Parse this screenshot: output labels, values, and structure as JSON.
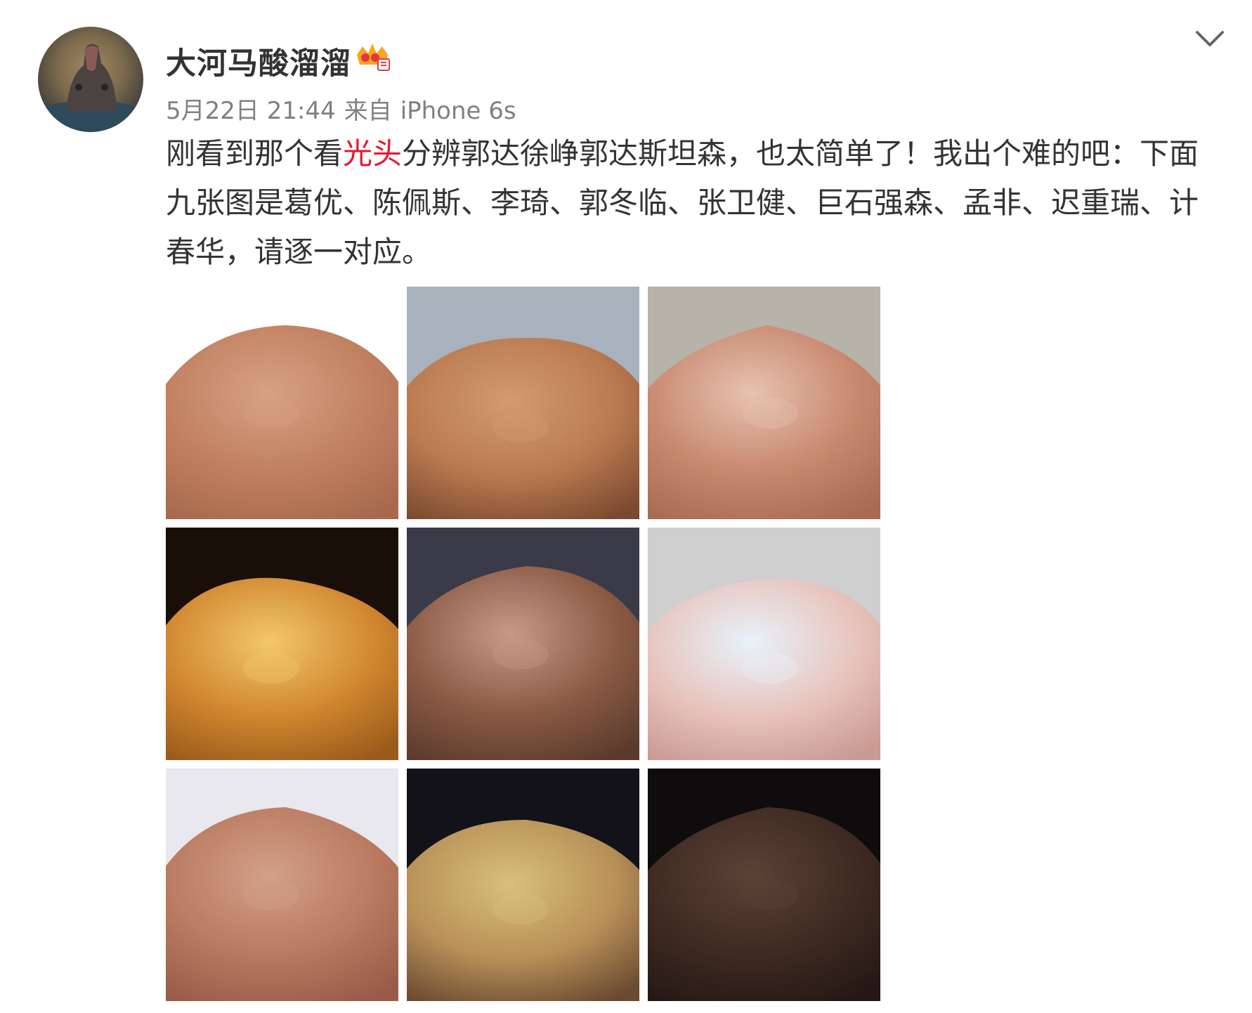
{
  "post": {
    "username": "大河马酸溜溜",
    "badge_icon": "vip-crown-icon",
    "timestamp": "5月22日 21:44",
    "source_prefix": "来自",
    "source_device": "iPhone 6s",
    "menu_icon": "chevron-down-icon",
    "text_before": "刚看到那个看",
    "hashtag": "光头",
    "text_after": "分辨郭达徐峥郭达斯坦森，也太简单了！我出个难的吧：下面九张图是葛优、陈佩斯、李琦、郭冬临、张卫健、巨石强森、孟非、迟重瑞、计春华，请逐一对应。",
    "link_color": "#e6162d",
    "images": [
      {
        "bg": "#ffffff",
        "skin": "#c08060",
        "light": "#d7a184",
        "dark": "#a8684c"
      },
      {
        "bg": "#a8b2bc",
        "skin": "#ba7a50",
        "light": "#d49a70",
        "dark": "#7a4a30"
      },
      {
        "bg": "#b8b3a8",
        "skin": "#c7886e",
        "light": "#e6c2b0",
        "dark": "#a86a52"
      },
      {
        "bg": "#1a0f08",
        "skin": "#d0862f",
        "light": "#f2c86a",
        "dark": "#9a5a1a"
      },
      {
        "bg": "#3a3a48",
        "skin": "#8a5a44",
        "light": "#c79a88",
        "dark": "#5a3a2c"
      },
      {
        "bg": "#cfcfcf",
        "skin": "#e8c3bc",
        "light": "#e8f2fa",
        "dark": "#c89a92"
      },
      {
        "bg": "#e8e8ee",
        "skin": "#b97a60",
        "light": "#d2a088",
        "dark": "#9a5a48"
      },
      {
        "bg": "#121218",
        "skin": "#b89058",
        "light": "#d8c07a",
        "dark": "#6a4a30"
      },
      {
        "bg": "#0e0c0c",
        "skin": "#3e2a22",
        "light": "#5a4236",
        "dark": "#241814"
      }
    ]
  }
}
